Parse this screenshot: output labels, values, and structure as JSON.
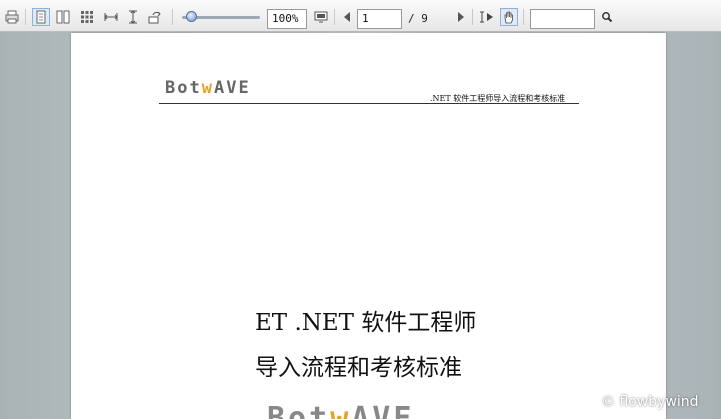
{
  "toolbar": {
    "zoom_value": "100%",
    "page_current": "1",
    "page_total": "/ 9",
    "search_value": ""
  },
  "document": {
    "logo_text_start": "Bot",
    "logo_text_accent": "w",
    "logo_text_end": "AVE",
    "header_text": ".NET 软件工程师导入流程和考核标准",
    "title_line1": "ET .NET 软件工程师",
    "title_line2": "导入流程和考核标准"
  },
  "watermark": "© flowbywind",
  "colors": {
    "accent": "#e3a325",
    "active_button": "#dfe9f7"
  }
}
